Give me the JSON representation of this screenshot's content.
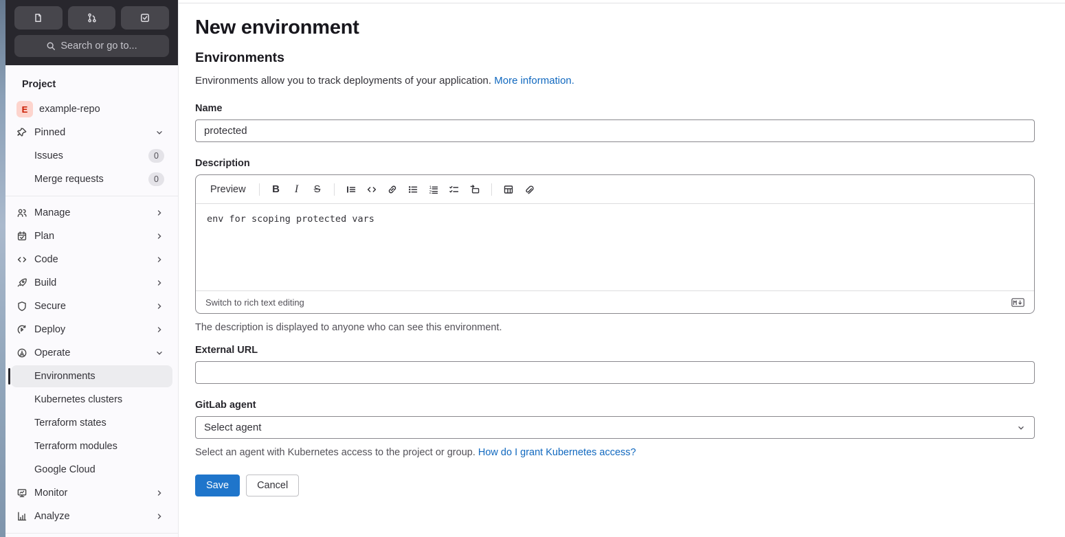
{
  "colors": {
    "accent_blue": "#1f75cb",
    "link_blue": "#1068bf",
    "sidebar_dark": "#28272d",
    "sidebar_bg": "#fbfafd",
    "active_item_bg": "#ececef",
    "avatar_bg": "#fdd4cd",
    "avatar_text": "#c91c00"
  },
  "sidebar": {
    "search_placeholder": "Search or go to...",
    "section_label": "Project",
    "project": {
      "avatar_letter": "E",
      "name": "example-repo"
    },
    "pinned": {
      "label": "Pinned",
      "items": [
        {
          "label": "Issues",
          "badge": "0"
        },
        {
          "label": "Merge requests",
          "badge": "0"
        }
      ]
    },
    "nav": [
      {
        "label": "Manage"
      },
      {
        "label": "Plan"
      },
      {
        "label": "Code"
      },
      {
        "label": "Build"
      },
      {
        "label": "Secure"
      },
      {
        "label": "Deploy"
      },
      {
        "label": "Operate"
      }
    ],
    "operate_children": [
      {
        "label": "Environments",
        "active": true
      },
      {
        "label": "Kubernetes clusters"
      },
      {
        "label": "Terraform states"
      },
      {
        "label": "Terraform modules"
      },
      {
        "label": "Google Cloud"
      }
    ],
    "nav_bottom": [
      {
        "label": "Monitor"
      },
      {
        "label": "Analyze"
      }
    ]
  },
  "main": {
    "title": "New environment",
    "section_heading": "Environments",
    "intro_text": "Environments allow you to track deployments of your application. ",
    "intro_link": "More information.",
    "name_field": {
      "label": "Name",
      "value": "protected"
    },
    "description_field": {
      "label": "Description",
      "toolbar": {
        "preview_label": "Preview",
        "bold_glyph": "B",
        "italic_glyph": "I",
        "strike_glyph": "S"
      },
      "value": "env for scoping protected vars",
      "footer_link": "Switch to rich text editing",
      "help_text": "The description is displayed to anyone who can see this environment."
    },
    "external_url_field": {
      "label": "External URL",
      "value": ""
    },
    "agent_field": {
      "label": "GitLab agent",
      "selected": "Select agent",
      "help_text": "Select an agent with Kubernetes access to the project or group. ",
      "help_link": "How do I grant Kubernetes access?"
    },
    "buttons": {
      "save": "Save",
      "cancel": "Cancel"
    }
  }
}
